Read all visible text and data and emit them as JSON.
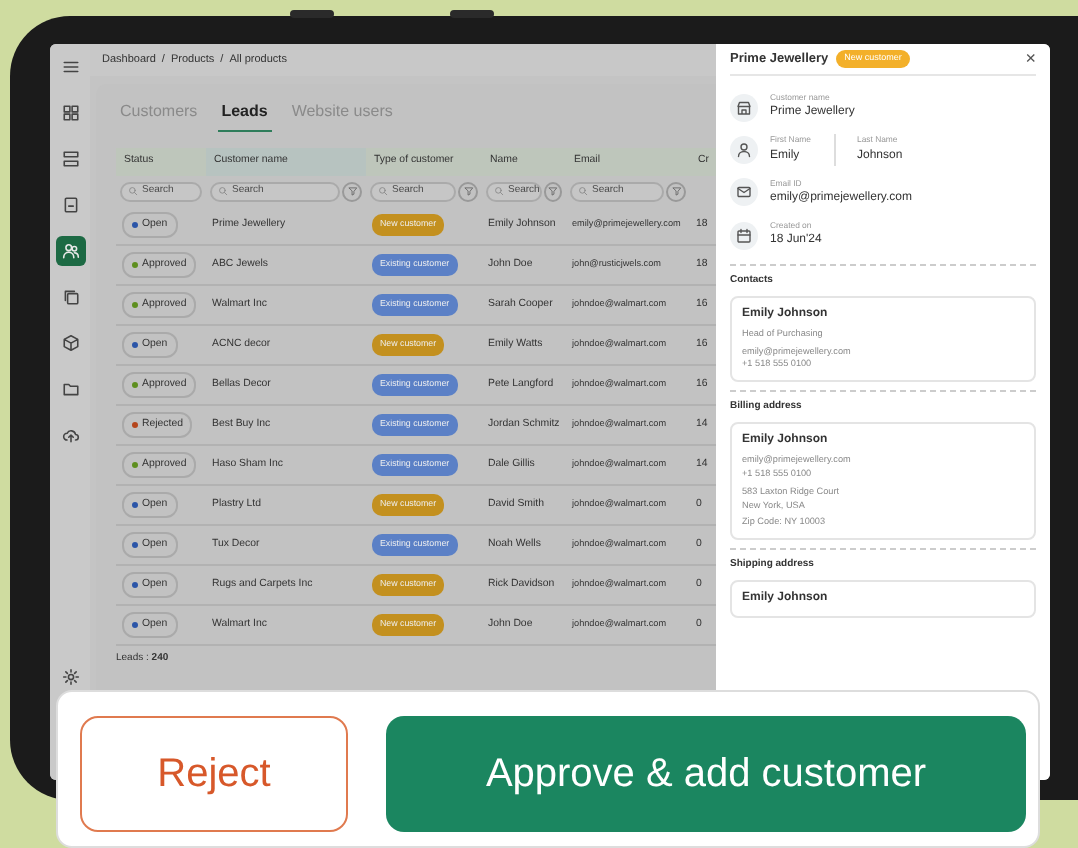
{
  "breadcrumb": {
    "items": [
      "Dashboard",
      "Products",
      "All products"
    ],
    "separator": "/"
  },
  "sidebar": [
    {
      "kind": "menu",
      "selected": false
    },
    {
      "kind": "grid",
      "selected": false
    },
    {
      "kind": "list",
      "selected": false
    },
    {
      "kind": "document",
      "selected": false
    },
    {
      "kind": "people",
      "selected": true
    },
    {
      "kind": "copy",
      "selected": false
    },
    {
      "kind": "cube",
      "selected": false
    },
    {
      "kind": "folder",
      "selected": false
    },
    {
      "kind": "cloud",
      "selected": false
    },
    {
      "kind": "settings",
      "selected": false
    }
  ],
  "tabs": [
    {
      "label": "Customers",
      "selected": false
    },
    {
      "label": "Leads",
      "selected": true
    },
    {
      "label": "Website users",
      "selected": false
    }
  ],
  "table": {
    "columns": [
      {
        "label": "Status",
        "filter": false,
        "placeholder": "Search"
      },
      {
        "label": "Customer name",
        "filter": true,
        "placeholder": "Search"
      },
      {
        "label": "Type of customer",
        "filter": true,
        "placeholder": "Search"
      },
      {
        "label": "Name",
        "filter": true,
        "placeholder": "Search"
      },
      {
        "label": "Email",
        "filter": true,
        "placeholder": "Search"
      },
      {
        "label": "Cr",
        "filter": false
      }
    ],
    "rows": [
      {
        "status": "Open",
        "color": "#2b55a8",
        "customer": "Prime Jewellery",
        "type": {
          "text": "New customer",
          "color": "#c3901f"
        },
        "name": "Emily Johnson",
        "email": "emily@primejewellery.com",
        "column_6": "18"
      },
      {
        "status": "Approved",
        "color": "#5e8f1f",
        "customer": "ABC Jewels",
        "type": {
          "text": "Existing customer",
          "color": "#5b80c6"
        },
        "name": "John Doe",
        "email": "john@rusticjwels.com",
        "column_6": "18"
      },
      {
        "status": "Approved",
        "color": "#5e8f1f",
        "customer": "Walmart Inc",
        "type": {
          "text": "Existing customer",
          "color": "#5b80c6"
        },
        "name": "Sarah Cooper",
        "email": "johndoe@walmart.com",
        "column_6": "16"
      },
      {
        "status": "Open",
        "color": "#2b55a8",
        "customer": "ACNC decor",
        "type": {
          "text": "New customer",
          "color": "#c3901f"
        },
        "name": "Emily Watts",
        "email": "johndoe@walmart.com",
        "column_6": "16"
      },
      {
        "status": "Approved",
        "color": "#5e8f1f",
        "customer": "Bellas Decor",
        "type": {
          "text": "Existing customer",
          "color": "#5b80c6"
        },
        "name": "Pete Langford",
        "email": "johndoe@walmart.com",
        "column_6": "16"
      },
      {
        "status": "Rejected",
        "color": "#b5461d",
        "customer": "Best Buy Inc",
        "type": {
          "text": "Existing customer",
          "color": "#5b80c6"
        },
        "name": "Jordan Schmitz",
        "email": "johndoe@walmart.com",
        "column_6": "14"
      },
      {
        "status": "Approved",
        "color": "#5e8f1f",
        "customer": "Haso Sham Inc",
        "type": {
          "text": "Existing customer",
          "color": "#5b80c6"
        },
        "name": "Dale Gillis",
        "email": "johndoe@walmart.com",
        "column_6": "14"
      },
      {
        "status": "Open",
        "color": "#2b55a8",
        "customer": "Plastry Ltd",
        "type": {
          "text": "New customer",
          "color": "#c3901f"
        },
        "name": "David Smith",
        "email": "johndoe@walmart.com",
        "column_6": "0"
      },
      {
        "status": "Open",
        "color": "#2b55a8",
        "customer": "Tux Decor",
        "type": {
          "text": "Existing customer",
          "color": "#5b80c6"
        },
        "name": "Noah Wells",
        "email": "johndoe@walmart.com",
        "column_6": "0"
      },
      {
        "status": "Open",
        "color": "#2b55a8",
        "customer": "Rugs and Carpets Inc",
        "type": {
          "text": "New customer",
          "color": "#c3901f"
        },
        "name": "Rick Davidson",
        "email": "johndoe@walmart.com",
        "column_6": "0"
      },
      {
        "status": "Open",
        "color": "#2b55a8",
        "customer": "Walmart Inc",
        "type": {
          "text": "New customer",
          "color": "#c3901f"
        },
        "name": "John Doe",
        "email": "johndoe@walmart.com",
        "column_6": "0"
      }
    ]
  },
  "footer": "Leads : **240**",
  "panel": {
    "title": "Prime Jewellery",
    "badge": "New customer",
    "close": "×",
    "fields": [
      {
        "kind": "store",
        "items": [
          {
            "label": "Customer name",
            "value": "Prime Jewellery"
          }
        ]
      },
      {
        "kind": "person",
        "items": [
          {
            "label": "First Name",
            "value": "Emily"
          },
          {
            "label": "Last Name",
            "value": "Johnson"
          }
        ]
      },
      {
        "kind": "mail",
        "items": [
          {
            "label": "Email ID",
            "value": "emily@primejewellery.com"
          }
        ]
      },
      {
        "kind": "calendar",
        "items": [
          {
            "label": "Created on",
            "value": "18 Jun'24"
          }
        ]
      }
    ],
    "sections": [
      {
        "heading": "Contacts",
        "name": "Emily Johnson",
        "lines": [
          [
            "Head of Purchasing"
          ],
          [
            "emily@primejewellery.com",
            "+1 518 555 0100"
          ]
        ]
      },
      {
        "heading": "Billing address",
        "name": "Emily Johnson",
        "lines": [
          [
            "emily@primejewellery.com",
            "+1 518 555 0100"
          ],
          [
            "583 Laxton Ridge Court",
            "New York, USA"
          ],
          [
            "Zip Code: NY 10003"
          ]
        ]
      },
      {
        "heading": "Shipping address",
        "name": "Emily Johnson"
      }
    ]
  },
  "actions": [
    {
      "label": "Reject",
      "kind": "reject"
    },
    {
      "label": "Approve & add customer",
      "kind": "approve"
    }
  ]
}
